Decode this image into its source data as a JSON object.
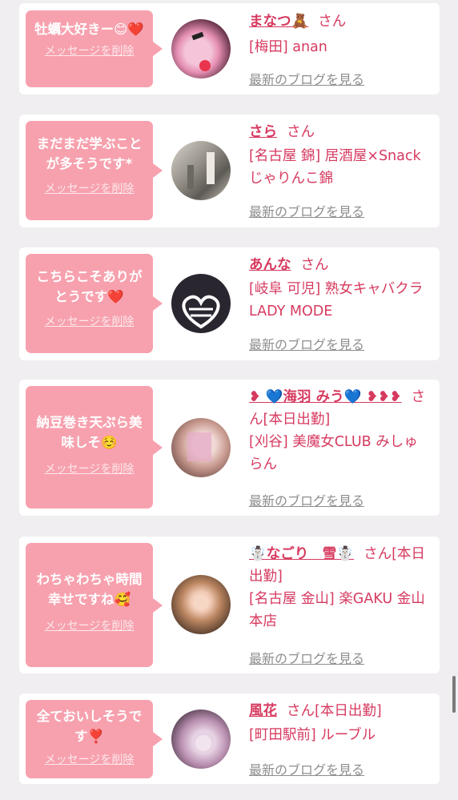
{
  "items": [
    {
      "message": "牡蠣大好きー😊❤️",
      "delete_label": "メッセージを削除",
      "name": "まなつ🧸",
      "san": "さん",
      "shop": "[梅田] anan",
      "blog_label": "最新のブログを見る"
    },
    {
      "message": "まだまだ学ぶことが多そうです*",
      "delete_label": "メッセージを削除",
      "name": "さら",
      "san": "さん",
      "shop": "[名古屋 錦] 居酒屋×Snack じゃりんこ錦",
      "blog_label": "最新のブログを見る"
    },
    {
      "message": "こちらこそありがとうです❤️",
      "delete_label": "メッセージを削除",
      "name": "あんな",
      "san": "さん",
      "shop": "[岐阜 可児] 熟女キャバクラ LADY MODE",
      "blog_label": "最新のブログを見る"
    },
    {
      "message": "納豆巻き天ぷら美味しそ☺️",
      "delete_label": "メッセージを削除",
      "name": "❥ 💙海羽 みう💙 ❥❥❥",
      "san": "さん",
      "status": "[本日出勤]",
      "shop": "[刈谷] 美魔女CLUB みしゅらん",
      "blog_label": "最新のブログを見る"
    },
    {
      "message": "わちゃわちゃ時間幸せですね🥰",
      "delete_label": "メッセージを削除",
      "name": "☃️なごり　雪☃️",
      "san": "さん",
      "status": "[本日出勤]",
      "shop": "[名古屋 金山] 楽GAKU 金山本店",
      "blog_label": "最新のブログを見る"
    },
    {
      "message": "全ておいしそうです❣️",
      "delete_label": "メッセージを削除",
      "name": "風花",
      "san": "さん",
      "status": "[本日出勤]",
      "shop": "[町田駅前] ルーブル",
      "blog_label": "最新のブログを見る"
    }
  ],
  "colors": {
    "accent": "#d63a5f",
    "bubble": "#f7a1ae",
    "link_gray": "#8e8e8e",
    "background": "#f0eef0"
  }
}
